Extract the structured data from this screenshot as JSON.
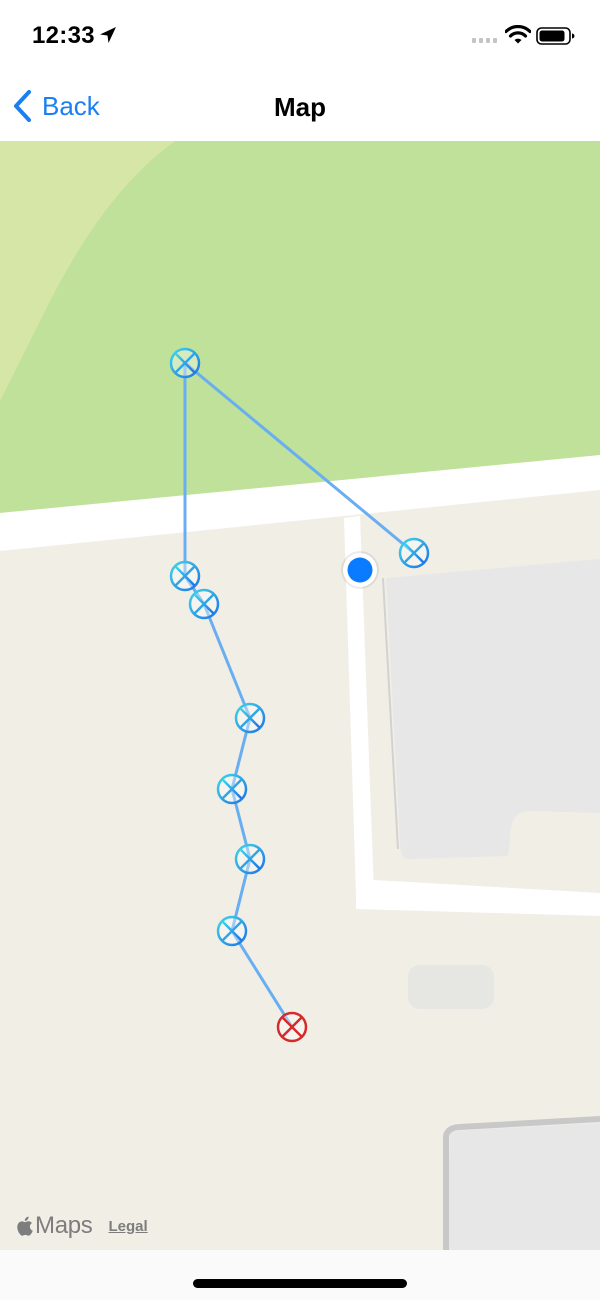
{
  "status_bar": {
    "time": "12:33",
    "icons": [
      "location-arrow-icon",
      "signal-dots-icon",
      "wifi-icon",
      "battery-icon"
    ]
  },
  "nav": {
    "back_label": "Back",
    "title": "Map",
    "accent_color": "#1a7ff2"
  },
  "map": {
    "attribution_brand": "Maps",
    "legal_label": "Legal",
    "colors": {
      "park": "#bfe19a",
      "land": "#f1eee6",
      "road": "#ffffff",
      "building": "#e7e7e7",
      "route_line": "#6aaef2",
      "waypoint": "#2f9ae8",
      "destination_waypoint": "#d62b2b",
      "user_location": "#0a7afe"
    },
    "waypoint_count": 10,
    "destination_count": 1
  }
}
